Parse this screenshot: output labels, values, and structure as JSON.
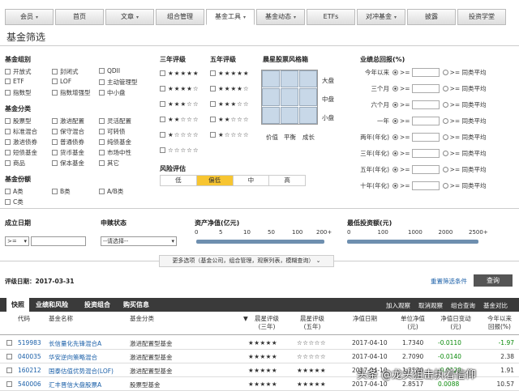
{
  "nav": {
    "tabs": [
      {
        "label": "会员",
        "caret": "▾"
      },
      {
        "label": "首页",
        "caret": ""
      },
      {
        "label": "文章",
        "caret": "▾"
      },
      {
        "label": "组合管理",
        "caret": ""
      },
      {
        "label": "基金工具",
        "caret": "▾"
      },
      {
        "label": "基金动态",
        "caret": "▾"
      },
      {
        "label": "ETFs",
        "caret": ""
      },
      {
        "label": "对冲基金",
        "caret": "▾"
      },
      {
        "label": "披露",
        "caret": ""
      },
      {
        "label": "投资学堂",
        "caret": ""
      }
    ],
    "active": "基金工具"
  },
  "page_title": "基金筛选",
  "fund_group": {
    "title": "基金组别",
    "items": [
      "开放式",
      "封闭式",
      "QDII",
      "ETF",
      "LOF",
      "主动管理型",
      "指数型",
      "指数增强型",
      "中小盘"
    ]
  },
  "fund_class": {
    "title": "基金分类",
    "items": [
      "股票型",
      "激进配置",
      "灵活配置",
      "标准混合",
      "保守混合",
      "可转债",
      "激进债券",
      "普通债券",
      "纯债基金",
      "短债基金",
      "货币基金",
      "市场中性",
      "商品",
      "保本基金",
      "其它"
    ]
  },
  "share_class": {
    "title": "基金份额",
    "items": [
      "A类",
      "B类",
      "A/B类",
      "C类"
    ]
  },
  "rating3": {
    "title": "三年评级"
  },
  "rating5": {
    "title": "五年评级"
  },
  "star_rows": [
    "★★★★★",
    "★★★★☆",
    "★★★☆☆",
    "★★☆☆☆",
    "★☆☆☆☆",
    "☆☆☆☆☆"
  ],
  "star_rows5": [
    "★★★★★",
    "★★★★☆",
    "★★★☆☆",
    "★★☆☆☆",
    "★☆☆☆☆"
  ],
  "style_box": {
    "title": "晨星股票风格箱",
    "rows": [
      "大盘",
      "中盘",
      "小盘"
    ],
    "cols": [
      "价值",
      "平衡",
      "成长"
    ]
  },
  "risk": {
    "title": "风险评估",
    "levels": [
      "低",
      "偏低",
      "中",
      "高"
    ],
    "selected": "偏低"
  },
  "performance": {
    "title": "业绩总回报(%)",
    "rows": [
      "今年以来",
      "三个月",
      "六个月",
      "一年",
      "两年(年化)",
      "三年(年化)",
      "五年(年化)",
      "十年(年化)"
    ],
    "gte": ">=",
    "peer": ">= 同类平均"
  },
  "inception": {
    "title": "成立日期",
    "op": ">=",
    "op_caret": "▾"
  },
  "purchase": {
    "title": "申赎状态",
    "select": "--请选择--",
    "caret": "▾"
  },
  "nav_range": {
    "title": "资产净值(亿元)",
    "ticks": [
      "0",
      "5",
      "10",
      "50",
      "100",
      "200+"
    ]
  },
  "min_invest": {
    "title": "最低投资额(元)",
    "ticks": [
      "0",
      "100",
      "1000",
      "2000",
      "2500+"
    ]
  },
  "more": {
    "label": "更多选项（基金公司，组合管理，观察列表，模糊查询）",
    "caret": "⌄"
  },
  "rating_date": {
    "label": "评级日期：2017-03-31"
  },
  "reset_label": "重置筛选条件",
  "search_label": "查询",
  "result_tabs": [
    "快照",
    "业绩和风险",
    "投资组合",
    "购买信息"
  ],
  "result_actions": [
    "加入观察",
    "取消观察",
    "组合查询",
    "基金对比"
  ],
  "columns": [
    "代码",
    "基金名称",
    "基金分类",
    "晨星评级\n(三年)",
    "晨星评级\n(五年)",
    "净值日期",
    "单位净值\n(元)",
    "净值日变动\n(元)",
    "今年以来\n回报(%)"
  ],
  "sort_arrow": "▼",
  "rows": [
    {
      "code": "519983",
      "name": "长信量化先锋混合A",
      "cls": "激进配置型基金",
      "s3": "★★★★★",
      "s5": "☆☆☆☆☆",
      "date": "2017-04-10",
      "nav": "1.7340",
      "chg": "-0.0110",
      "ret": "-1.97"
    },
    {
      "code": "040035",
      "name": "华安逆向策略混合",
      "cls": "激进配置型基金",
      "s3": "★★★★★",
      "s5": "☆☆☆☆☆",
      "date": "2017-04-10",
      "nav": "2.7090",
      "chg": "-0.0140",
      "ret": "2.38"
    },
    {
      "code": "160212",
      "name": "国泰估值优势混合(LOF)",
      "cls": "激进配置型基金",
      "s3": "★★★★★",
      "s5": "★★★★★",
      "date": "2017-04-10",
      "nav": "1.3530",
      "chg": "-0.0120",
      "ret": "1.91"
    },
    {
      "code": "540006",
      "name": "汇丰晋信大盘股票A",
      "cls": "股票型基金",
      "s3": "★★★★★",
      "s5": "★★★★★",
      "date": "2017-04-10",
      "nav": "2.8517",
      "chg": "0.0088",
      "ret": "10.57"
    }
  ],
  "watermark": "头条 @龙头狙击执着信仰"
}
